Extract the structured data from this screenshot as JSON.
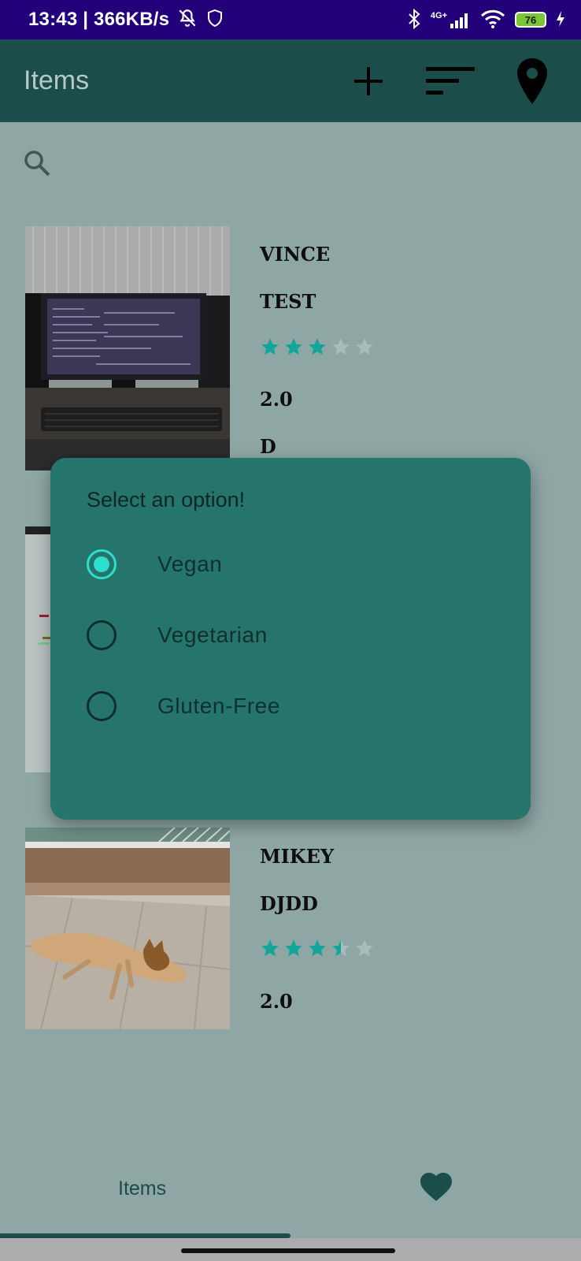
{
  "status_bar": {
    "time_speed": "13:43 | 366KB/s",
    "network": "4G+",
    "battery": "76",
    "icons": [
      "mute-icon",
      "shield-icon",
      "bluetooth-icon",
      "signal-icon",
      "wifi-icon",
      "battery-icon",
      "charging-icon"
    ]
  },
  "app_bar": {
    "title": "Items",
    "icons": [
      "add-icon",
      "sort-icon",
      "location-pin-icon"
    ]
  },
  "search": {
    "icon": "search-icon"
  },
  "items": [
    {
      "name": "VINCE",
      "subtitle": "TEST",
      "rating": 3,
      "rating_max": 5,
      "value": "2.0",
      "extra": "D",
      "image": "computer monitor on desk"
    },
    {
      "name": "",
      "subtitle": "",
      "rating": null,
      "value": "",
      "extra": "",
      "image": "screenshot"
    },
    {
      "name": "MIKEY",
      "subtitle": "DJDD",
      "rating": 3.5,
      "rating_max": 5,
      "value": "2.0",
      "extra": "",
      "image": "small dog lying on a sunny patio"
    }
  ],
  "dialog": {
    "title": "Select an option!",
    "options": [
      {
        "label": "Vegan",
        "selected": true
      },
      {
        "label": "Vegetarian",
        "selected": false
      },
      {
        "label": "Gluten-Free",
        "selected": false
      }
    ]
  },
  "bottom_nav": {
    "items_label": "Items",
    "favorites_icon": "heart-icon"
  },
  "colors": {
    "status_bar": "#22007a",
    "app_bar": "#1b4e4b",
    "scrim_background": "#8ea7a5",
    "dialog": "#26756d",
    "radio_selected": "#2ee0cb",
    "star_filled": "#14a59a",
    "star_empty": "#a8bcbb"
  }
}
